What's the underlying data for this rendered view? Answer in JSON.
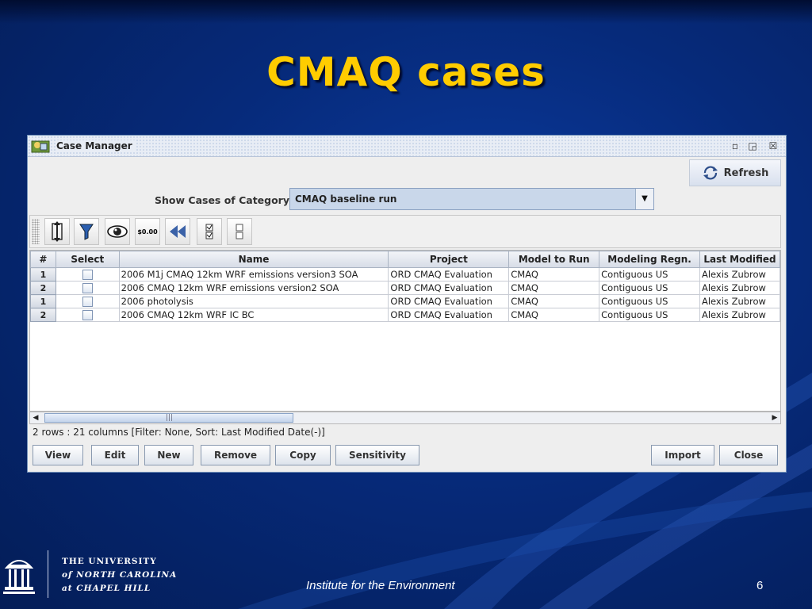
{
  "slide": {
    "title": "CMAQ cases",
    "footer_center": "Institute for the Environment",
    "page_number": "6",
    "university_lines": [
      "THE UNIVERSITY",
      "of NORTH CAROLINA",
      "at CHAPEL HILL"
    ]
  },
  "window": {
    "title": "Case Manager",
    "refresh_label": "Refresh",
    "category_label": "Show Cases of Category:",
    "category_value": "CMAQ baseline run",
    "toolbar_icons": [
      "sort-icon",
      "filter-icon",
      "view-icon",
      "format-icon",
      "reset-icon",
      "select-all-icon",
      "clear-all-icon"
    ],
    "format_icon_text": "$0.00"
  },
  "table": {
    "columns": [
      "#",
      "Select",
      "Name",
      "Project",
      "Model to Run",
      "Modeling Regn.",
      "Last Modified"
    ],
    "rows": [
      {
        "num": "1",
        "name": "2006 M1j CMAQ 12km WRF emissions version3 SOA",
        "project": "ORD CMAQ Evaluation",
        "model": "CMAQ",
        "region": "Contiguous US",
        "modified": "Alexis Zubrow"
      },
      {
        "num": "2",
        "name": "2006 CMAQ 12km WRF emissions version2 SOA",
        "project": "ORD CMAQ Evaluation",
        "model": "CMAQ",
        "region": "Contiguous US",
        "modified": "Alexis Zubrow"
      },
      {
        "num": "1",
        "name": "2006 photolysis",
        "project": "ORD CMAQ Evaluation",
        "model": "CMAQ",
        "region": "Contiguous US",
        "modified": "Alexis Zubrow"
      },
      {
        "num": "2",
        "name": "2006 CMAQ 12km WRF IC BC",
        "project": "ORD CMAQ Evaluation",
        "model": "CMAQ",
        "region": "Contiguous US",
        "modified": "Alexis Zubrow"
      }
    ]
  },
  "status": "2 rows : 21 columns [Filter: None, Sort: Last Modified Date(-)]",
  "buttons": {
    "view": "View",
    "edit": "Edit",
    "new": "New",
    "remove": "Remove",
    "copy": "Copy",
    "sensitivity": "Sensitivity",
    "import": "Import",
    "close": "Close"
  },
  "colors": {
    "title": "#ffcc00",
    "background": "#062a7a",
    "window_border": "#6f8fb8",
    "select_box": "#c9d7ea"
  }
}
